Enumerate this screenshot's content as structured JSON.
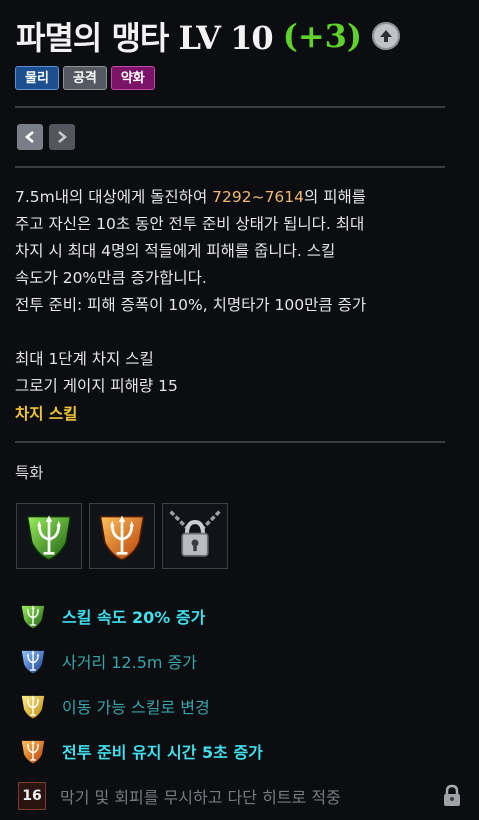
{
  "skill": {
    "name": "파멸의 맹타 LV 10",
    "level_bonus": "(+3)"
  },
  "tags": [
    "물리",
    "공격",
    "약화"
  ],
  "description": {
    "line1_pre": "7.5m내의 대상에게 돌진하여 ",
    "damage": "7292~7614",
    "line1_post": "의 피해를",
    "line2": "주고 자신은 10초 동안 전투 준비 상태가 됩니다. 최대",
    "line3": "차지 시 최대 4명의 적들에게 피해를 줍니다. 스킬",
    "line4": "속도가 20%만큼 증가합니다.",
    "line5": "전투 준비: 피해 증폭이 10%, 치명타가 100만큼 증가",
    "line6": "최대 1단계 차지 스킬",
    "line7": "그로기 게이지 피해량 15"
  },
  "charge_label": "차지 스킬",
  "spec_label": "특화",
  "tripods": [
    {
      "text": "스킬 속도 20% 증가",
      "icon": "green-trident-icon"
    },
    {
      "text": "사거리 12.5m 증가",
      "icon": "blue-trident-icon"
    },
    {
      "text": "이동 가능 스킬로 변경",
      "icon": "gold-trident-icon"
    },
    {
      "text": "전투 준비 유지 시간 5초 증가",
      "icon": "orange-trident-icon"
    },
    {
      "text": "막기 및 회피를 무시하고 다단 히트로 적중",
      "level": "16",
      "icon": "lock-icon"
    }
  ],
  "colors": {
    "background": "#0b0d11",
    "plus_green": "#5fd22c",
    "damage_orange": "#f5b871",
    "charge_gold": "#f3c637",
    "active_cyan": "#3fdfec",
    "inactive_teal": "#3aa3a8",
    "locked_gray": "#777b80"
  }
}
